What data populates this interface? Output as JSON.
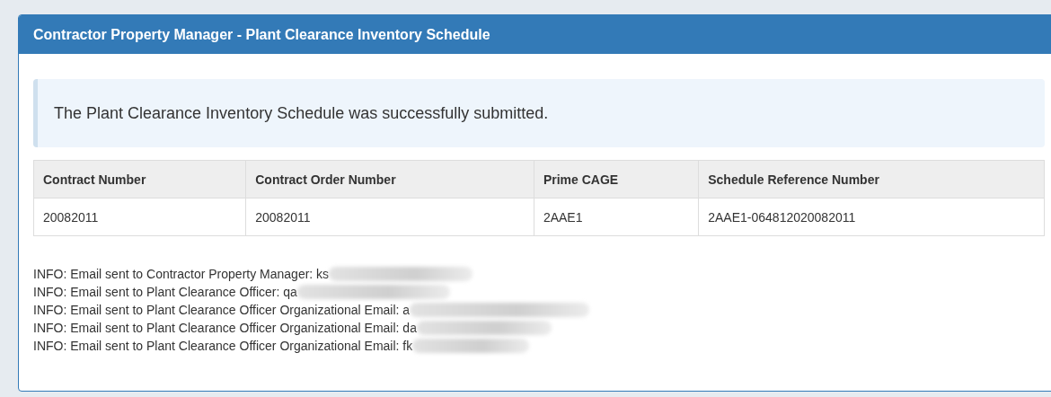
{
  "panel": {
    "title": "Contractor Property Manager - Plant Clearance Inventory Schedule"
  },
  "alert": {
    "message": "The Plant Clearance Inventory Schedule was successfully submitted."
  },
  "table": {
    "columns": [
      "Contract Number",
      "Contract Order Number",
      "Prime CAGE",
      "Schedule Reference Number"
    ],
    "rows": [
      [
        "20082011",
        "20082011",
        "2AAE1",
        "2AAE1-064812020082011"
      ]
    ]
  },
  "info_lines": [
    {
      "text": "INFO: Email sent to Contractor Property Manager: ks"
    },
    {
      "text": "INFO: Email sent to Plant Clearance Officer: qa"
    },
    {
      "text": "INFO: Email sent to Plant Clearance Officer Organizational Email: a"
    },
    {
      "text": "INFO: Email sent to Plant Clearance Officer Organizational Email: da"
    },
    {
      "text": "INFO: Email sent to Plant Clearance Officer Organizational Email: fk"
    }
  ]
}
